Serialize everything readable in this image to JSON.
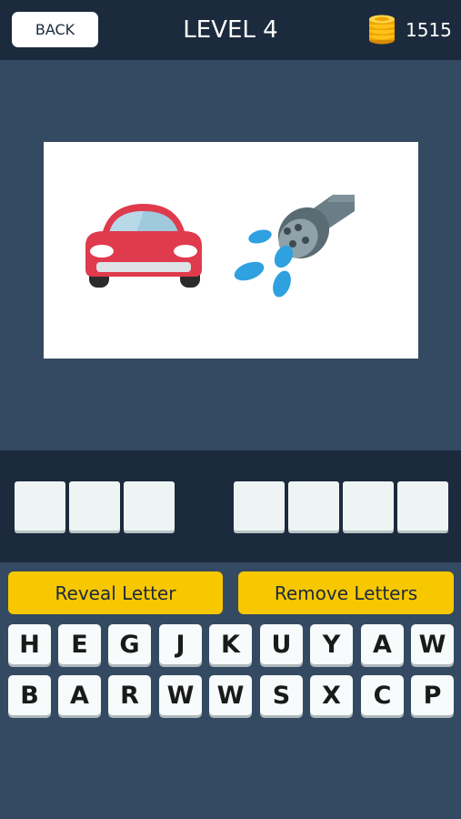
{
  "header": {
    "back_label": "BACK",
    "level_title": "LEVEL 4",
    "coins": "1515",
    "coins_icon": "coin-stack-icon"
  },
  "puzzle": {
    "emojis": [
      "car-icon",
      "shower-head-icon"
    ]
  },
  "answer": {
    "word_lengths": [
      3,
      4
    ]
  },
  "hints": {
    "reveal_label": "Reveal Letter",
    "remove_label": "Remove Letters"
  },
  "keyboard": {
    "row1": [
      "H",
      "E",
      "G",
      "J",
      "K",
      "U",
      "Y",
      "A",
      "W"
    ],
    "row2": [
      "B",
      "A",
      "R",
      "W",
      "W",
      "S",
      "X",
      "C",
      "P"
    ]
  },
  "colors": {
    "background": "#344a62",
    "bar": "#1c2a3d",
    "accent": "#f7c700"
  }
}
